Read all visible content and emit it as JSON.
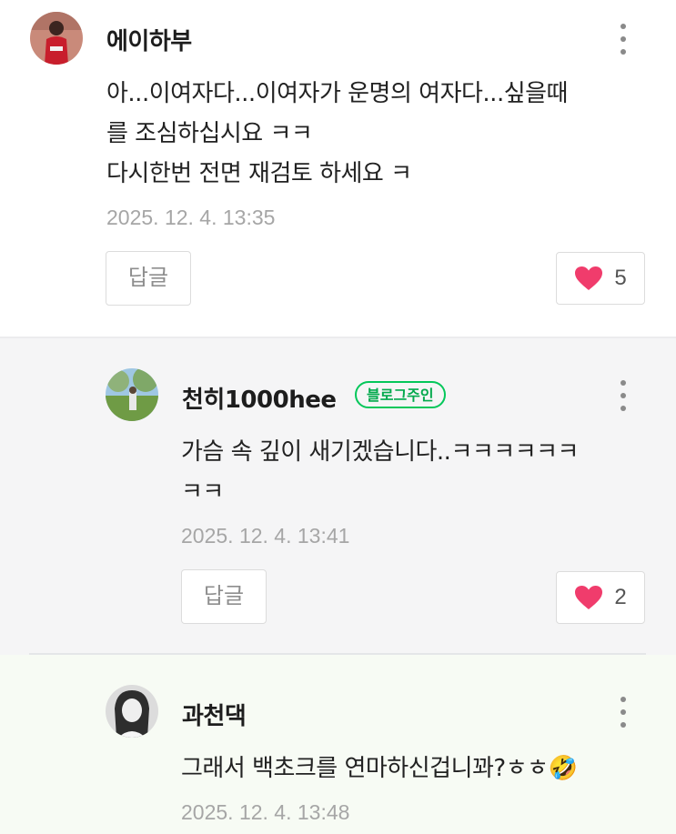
{
  "colors": {
    "like_heart": "#f03c6c",
    "owner_badge": "#03c75a"
  },
  "comments": [
    {
      "author": "에이하부",
      "lines": [
        "아...이여자다...이여자가 운명의 여자다...싶을때",
        "를 조심하십시요 ㅋㅋ",
        "다시한번 전면 재검토 하세요 ㅋ"
      ],
      "date": "2025. 12. 4. 13:35",
      "reply_label": "답글",
      "likes": "5"
    },
    {
      "author": "천히1000hee",
      "badge": "블로그주인",
      "lines": [
        "가슴 속 깊이 새기겠습니다..ㅋㅋㅋㅋㅋㅋ",
        "ㅋㅋ"
      ],
      "date": "2025. 12. 4. 13:41",
      "reply_label": "답글",
      "likes": "2"
    },
    {
      "author": "과천댁",
      "lines": [
        "그래서 백초크를 연마하신겁니꽈?ㅎㅎ🤣"
      ],
      "date": "2025. 12. 4. 13:48"
    }
  ]
}
